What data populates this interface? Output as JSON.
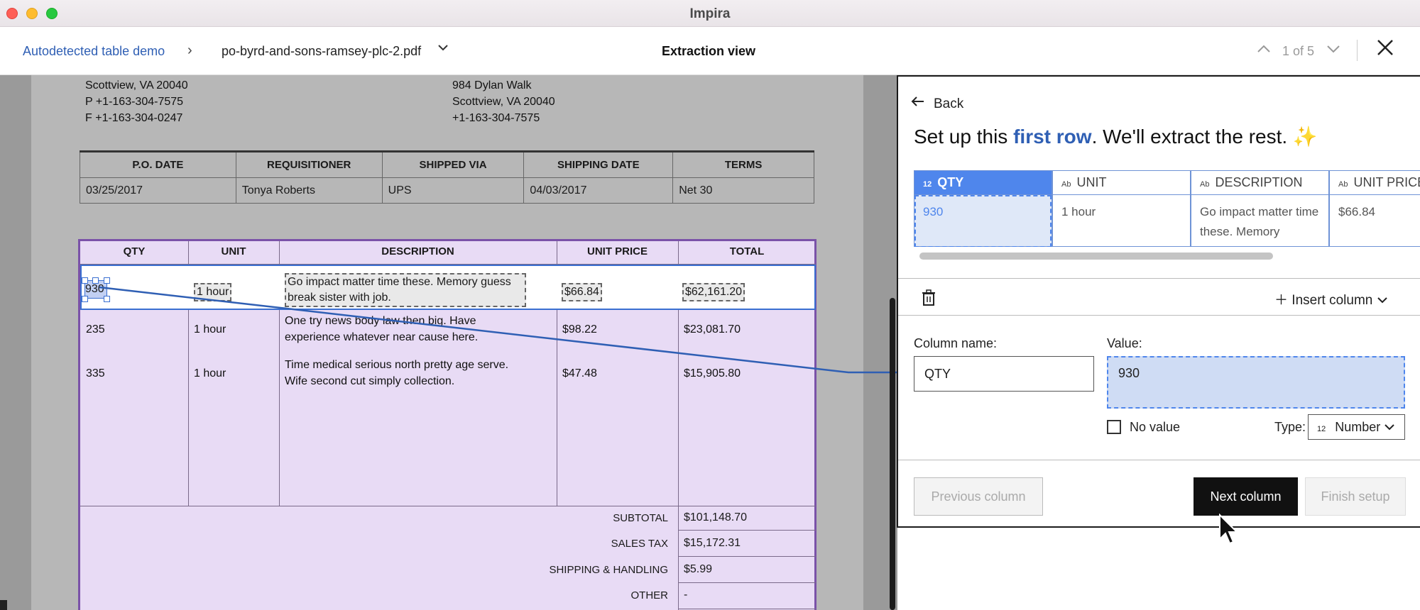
{
  "window": {
    "title": "Impira"
  },
  "header": {
    "breadcrumb_link": "Autodetected table demo",
    "file_name": "po-byrd-and-sons-ramsey-plc-2.pdf",
    "view_title": "Extraction view",
    "pager": "1 of 5"
  },
  "document": {
    "vendor_address": [
      "Scottview, VA 20040",
      "P +1-163-304-7575",
      "F +1-163-304-0247"
    ],
    "ship_address": [
      "984 Dylan Walk",
      "Scottview, VA 20040",
      "+1-163-304-7575"
    ],
    "po_table": {
      "headers": [
        "P.O. DATE",
        "REQUISITIONER",
        "SHIPPED VIA",
        "SHIPPING DATE",
        "TERMS"
      ],
      "row": [
        "03/25/2017",
        "Tonya Roberts",
        "UPS",
        "04/03/2017",
        "Net 30"
      ]
    },
    "items_table": {
      "headers": [
        "QTY",
        "UNIT",
        "DESCRIPTION",
        "UNIT PRICE",
        "TOTAL"
      ],
      "rows": [
        {
          "qty": "930",
          "unit": "1 hour",
          "desc1": "Go impact matter time these. Memory guess",
          "desc2": "break sister with job.",
          "price": "$66.84",
          "total": "$62,161.20"
        },
        {
          "qty": "235",
          "unit": "1 hour",
          "desc1": "One try news body law then big. Have",
          "desc2": "experience whatever near cause here.",
          "price": "$98.22",
          "total": "$23,081.70"
        },
        {
          "qty": "335",
          "unit": "1 hour",
          "desc1": "Time medical serious north pretty age serve.",
          "desc2": "Wife second cut simply collection.",
          "price": "$47.48",
          "total": "$15,905.80"
        }
      ],
      "totals": [
        {
          "label": "SUBTOTAL",
          "value": "$101,148.70"
        },
        {
          "label": "SALES TAX",
          "value": "$15,172.31"
        },
        {
          "label": "SHIPPING & HANDLING",
          "value": "$5.99"
        },
        {
          "label": "OTHER",
          "value": "-"
        }
      ]
    }
  },
  "panel": {
    "back_label": "Back",
    "title_pre": "Set up this ",
    "title_hl": "first row",
    "title_post": ". We'll extract the rest. ✨",
    "grid_columns": [
      {
        "type": "12",
        "name": "QTY",
        "value": "930"
      },
      {
        "type": "Ab",
        "name": "UNIT",
        "value": "1 hour"
      },
      {
        "type": "Ab",
        "name": "DESCRIPTION",
        "value": "Go impact matter time these. Memory"
      },
      {
        "type": "Ab",
        "name": "UNIT PRICE",
        "value": "$66.84"
      }
    ],
    "insert_column": "Insert column",
    "column_name_label": "Column name:",
    "column_name_value": "QTY",
    "value_label": "Value:",
    "value_value": "930",
    "no_value_label": "No value",
    "type_label": "Type:",
    "type_icon": "12",
    "type_value": "Number",
    "prev_button": "Previous column",
    "next_button": "Next column",
    "finish_button": "Finish setup"
  },
  "colors": {
    "accent": "#2f5fb4",
    "selection": "#4f86ec",
    "table_highlight": "#e8dbf5"
  }
}
